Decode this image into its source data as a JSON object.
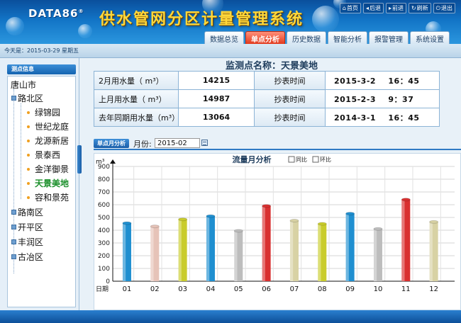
{
  "header": {
    "logo": "DATA86",
    "logo_mark": "®",
    "title": "供水管网分区计量管理系统",
    "toplinks": [
      {
        "icon": "home-icon",
        "glyph": "⌂",
        "label": "首页"
      },
      {
        "icon": "back-icon",
        "glyph": "◂",
        "label": "后退"
      },
      {
        "icon": "forward-icon",
        "glyph": "▸",
        "label": "前进"
      },
      {
        "icon": "refresh-icon",
        "glyph": "↻",
        "label": "刷新"
      },
      {
        "icon": "power-icon",
        "glyph": "⏻",
        "label": "退出"
      }
    ],
    "tabs": [
      {
        "label": "数据总览",
        "active": false
      },
      {
        "label": "单点分析",
        "active": true
      },
      {
        "label": "历史数据",
        "active": false
      },
      {
        "label": "智能分析",
        "active": false
      },
      {
        "label": "报警管理",
        "active": false
      },
      {
        "label": "系统设置",
        "active": false
      }
    ]
  },
  "date_bar": {
    "text": "今天是：2015-03-29 星期五"
  },
  "sidebar": {
    "title": "测点信息",
    "tree": [
      {
        "label": "唐山市",
        "kind": "root"
      },
      {
        "label": "路北区",
        "kind": "district"
      },
      {
        "label": "绿锦园",
        "kind": "point"
      },
      {
        "label": "世纪龙庭",
        "kind": "point"
      },
      {
        "label": "龙源新居",
        "kind": "point"
      },
      {
        "label": "景泰西",
        "kind": "point"
      },
      {
        "label": "金洋御景",
        "kind": "point"
      },
      {
        "label": "天景美地",
        "kind": "point",
        "selected": true
      },
      {
        "label": "容和景苑",
        "kind": "point"
      },
      {
        "label": "路南区",
        "kind": "district"
      },
      {
        "label": "开平区",
        "kind": "district"
      },
      {
        "label": "丰润区",
        "kind": "district"
      },
      {
        "label": "古冶区",
        "kind": "district"
      }
    ]
  },
  "main": {
    "station_title": "监测点名称：天景美地",
    "info_rows": [
      {
        "label": "2月用水量（ m³）",
        "value": "14215",
        "time_label": "抄表时间",
        "date": "2015-3-2",
        "time": "16：45"
      },
      {
        "label": "上月用水量（ m³）",
        "value": "14987",
        "time_label": "抄表时间",
        "date": "2015-2-3",
        "time": "9：37"
      },
      {
        "label": "去年同期用水量（m³）",
        "value": "13064",
        "time_label": "抄表时间",
        "date": "2014-3-1",
        "time": "16：45"
      }
    ],
    "month_tab": "单点月分析",
    "month_label": "月份:",
    "month_value": "2015-02"
  },
  "chart_data": {
    "type": "bar",
    "title": "流量月分析",
    "checkboxes": [
      {
        "label": "同比",
        "checked": false
      },
      {
        "label": "环比",
        "checked": false
      }
    ],
    "ylabel": "m³",
    "xlabel": "日期",
    "ylim": [
      0,
      900
    ],
    "yticks": [
      0,
      100,
      200,
      300,
      400,
      500,
      600,
      700,
      800,
      900
    ],
    "grid": true,
    "categories": [
      "01",
      "02",
      "03",
      "04",
      "05",
      "06",
      "07",
      "08",
      "09",
      "10",
      "11",
      "12"
    ],
    "values": [
      455,
      430,
      485,
      510,
      395,
      590,
      475,
      450,
      530,
      410,
      640,
      465
    ],
    "colors": [
      "#1f8fd0",
      "#e6c3b8",
      "#c9cc2c",
      "#1f8fd0",
      "#bdbdbd",
      "#d93030",
      "#d8d2a4",
      "#c9cc2c",
      "#1f8fd0",
      "#bdbdbd",
      "#d93030",
      "#d8d2a4"
    ]
  }
}
